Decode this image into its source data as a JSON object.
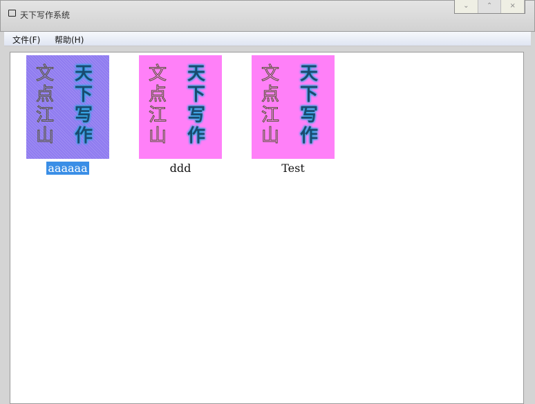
{
  "window": {
    "title": "天下写作系统",
    "controls": [
      "⌄",
      "⌃",
      "×"
    ]
  },
  "menu": [
    "文件(F)",
    "帮助(H)"
  ],
  "items": [
    {
      "name": "aaaaaa",
      "bg": "#8f7bf0",
      "selected": true
    },
    {
      "name": "ddd",
      "bg": "#ff80f8",
      "selected": false
    },
    {
      "name": "Test",
      "bg": "#ff80f8",
      "selected": false
    }
  ],
  "cover": {
    "left": [
      "文",
      "点",
      "江",
      "山"
    ],
    "right": [
      "天",
      "下",
      "写",
      "作"
    ]
  }
}
